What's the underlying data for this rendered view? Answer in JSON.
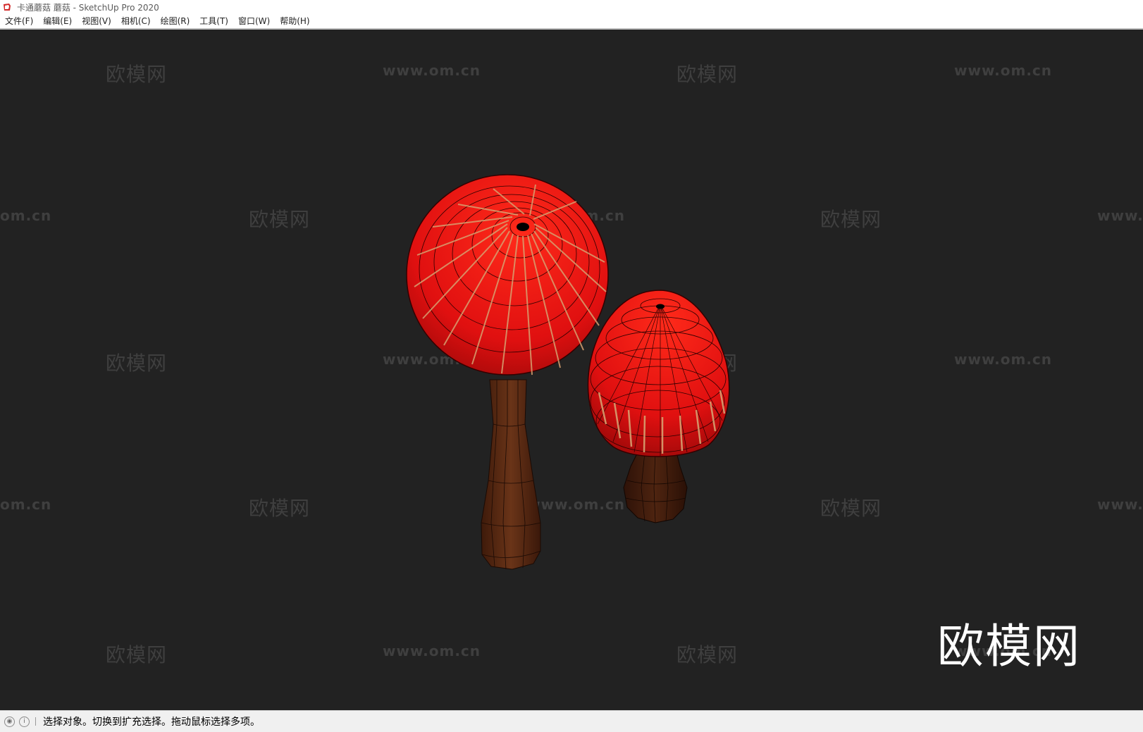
{
  "window": {
    "title": "卡通蘑菇 蘑菇 - SketchUp Pro 2020"
  },
  "menu": [
    {
      "key": "file",
      "label": "文件(F)"
    },
    {
      "key": "edit",
      "label": "编辑(E)"
    },
    {
      "key": "view",
      "label": "视图(V)"
    },
    {
      "key": "camera",
      "label": "相机(C)"
    },
    {
      "key": "draw",
      "label": "绘图(R)"
    },
    {
      "key": "tools",
      "label": "工具(T)"
    },
    {
      "key": "window",
      "label": "窗口(W)"
    },
    {
      "key": "help",
      "label": "帮助(H)"
    }
  ],
  "viewport": {
    "background": "#222222",
    "watermark_cn": "欧模网",
    "watermark_url": "www.om.cn",
    "watermark_url_cut": "om.cn",
    "watermark_url_cut_right": "www.",
    "logo_text": "欧模网"
  },
  "model": {
    "cap_color": "#e41010",
    "stem_color": "#5a2a14",
    "edge_color": "#000000"
  },
  "status": {
    "message": "选择对象。切换到扩充选择。拖动鼠标选择多项。",
    "icon_1": "geolocation-icon",
    "icon_2": "info-icon"
  }
}
